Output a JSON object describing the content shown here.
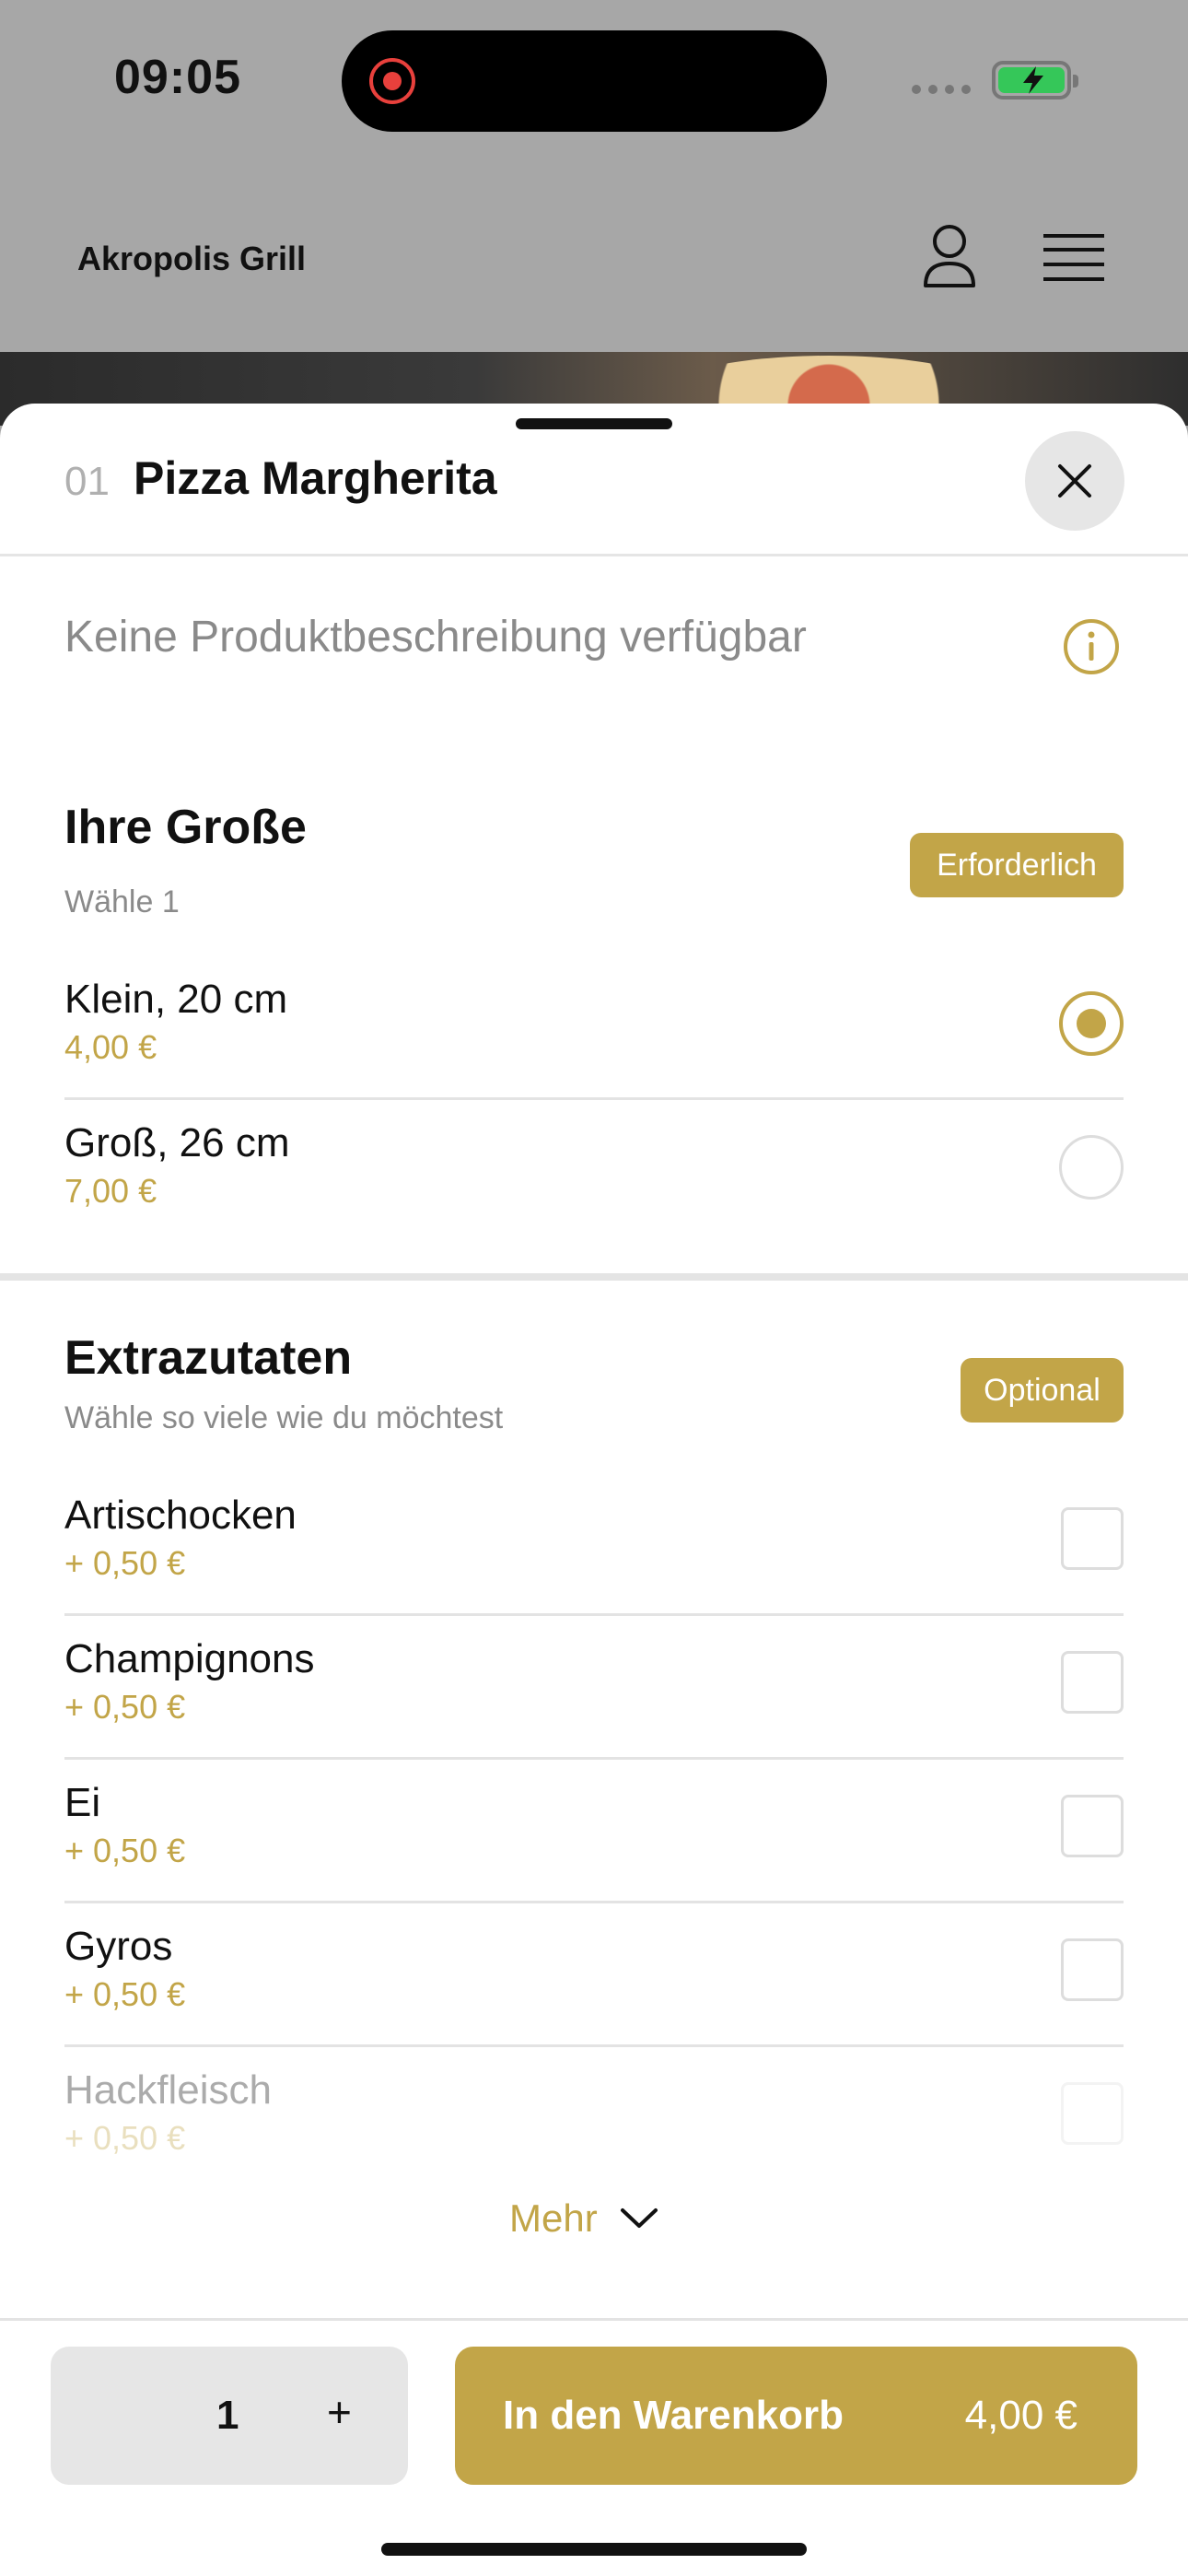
{
  "status": {
    "time": "09:05"
  },
  "header": {
    "brand": "Akropolis Grill"
  },
  "product": {
    "number": "01",
    "name": "Pizza Margherita",
    "description": "Keine Produktbeschreibung verfügbar"
  },
  "size_group": {
    "title": "Ihre Große",
    "subtitle": "Wähle 1",
    "badge": "Erforderlich",
    "options": [
      {
        "name": "Klein, 20 cm",
        "price": "4,00 €",
        "selected": true
      },
      {
        "name": "Groß, 26 cm",
        "price": "7,00 €",
        "selected": false
      }
    ]
  },
  "extras_group": {
    "title": "Extrazutaten",
    "subtitle": "Wähle so viele wie du möchtest",
    "badge": "Optional",
    "options": [
      {
        "name": "Artischocken",
        "price": "+ 0,50 €",
        "checked": false
      },
      {
        "name": "Champignons",
        "price": "+ 0,50 €",
        "checked": false
      },
      {
        "name": "Ei",
        "price": "+ 0,50 €",
        "checked": false
      },
      {
        "name": "Gyros",
        "price": "+ 0,50 €",
        "checked": false
      },
      {
        "name": "Hackfleisch",
        "price": "+ 0,50 €",
        "checked": false
      }
    ],
    "more_label": "Mehr"
  },
  "footer": {
    "quantity": "1",
    "plus_label": "+",
    "cart_label": "In den Warenkorb",
    "cart_price": "4,00 €"
  },
  "colors": {
    "accent": "#c2a548",
    "overlay": "#a7a7a7",
    "battery": "#35c759"
  }
}
